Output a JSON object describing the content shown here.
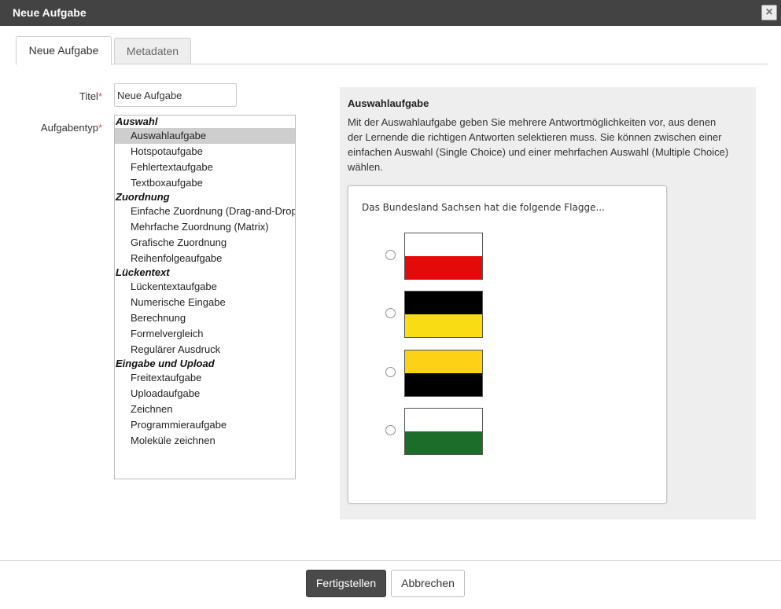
{
  "dialog": {
    "title": "Neue Aufgabe",
    "close_icon": "close-icon"
  },
  "tabs": [
    {
      "label": "Neue Aufgabe",
      "active": true
    },
    {
      "label": "Metadaten",
      "active": false
    }
  ],
  "form": {
    "title_label": "Titel",
    "title_required": "*",
    "title_value": "Neue Aufgabe",
    "type_label": "Aufgabentyp",
    "type_required": "*"
  },
  "task_types": {
    "selected": "Auswahlaufgabe",
    "groups": [
      {
        "label": "Auswahl",
        "options": [
          "Auswahlaufgabe",
          "Hotspotaufgabe",
          "Fehlertextaufgabe",
          "Textboxaufgabe"
        ]
      },
      {
        "label": "Zuordnung",
        "options": [
          "Einfache Zuordnung (Drag-and-Drop)",
          "Mehrfache Zuordnung (Matrix)",
          "Grafische Zuordnung",
          "Reihenfolgeaufgabe"
        ]
      },
      {
        "label": "Lückentext",
        "options": [
          "Lückentextaufgabe",
          "Numerische Eingabe",
          "Berechnung",
          "Formelvergleich",
          "Regulärer Ausdruck"
        ]
      },
      {
        "label": "Eingabe und Upload",
        "options": [
          "Freitextaufgabe",
          "Uploadaufgabe",
          "Zeichnen",
          "Programmieraufgabe",
          "Moleküle zeichnen"
        ]
      }
    ]
  },
  "preview": {
    "title": "Auswahlaufgabe",
    "description": "Mit der Auswahlaufgabe geben Sie mehrere Antwortmöglichkeiten vor, aus denen der Lernende die richtigen Antworten selektieren muss. Sie können zwischen einer einfachen Auswahl (Single Choice) und einer mehrfachen Auswahl (Multiple Choice) wählen.",
    "sample": {
      "question": "Das Bundesland Sachsen hat die folgende Flagge...",
      "choices": [
        {
          "flag_colors": [
            "#ffffff",
            "#e30a0a"
          ]
        },
        {
          "flag_colors": [
            "#000000",
            "#f9dc14"
          ]
        },
        {
          "flag_colors": [
            "#fcd116",
            "#000000"
          ]
        },
        {
          "flag_colors": [
            "#ffffff",
            "#1c6d2a"
          ]
        }
      ]
    }
  },
  "footer": {
    "finish_label": "Fertigstellen",
    "cancel_label": "Abbrechen"
  }
}
